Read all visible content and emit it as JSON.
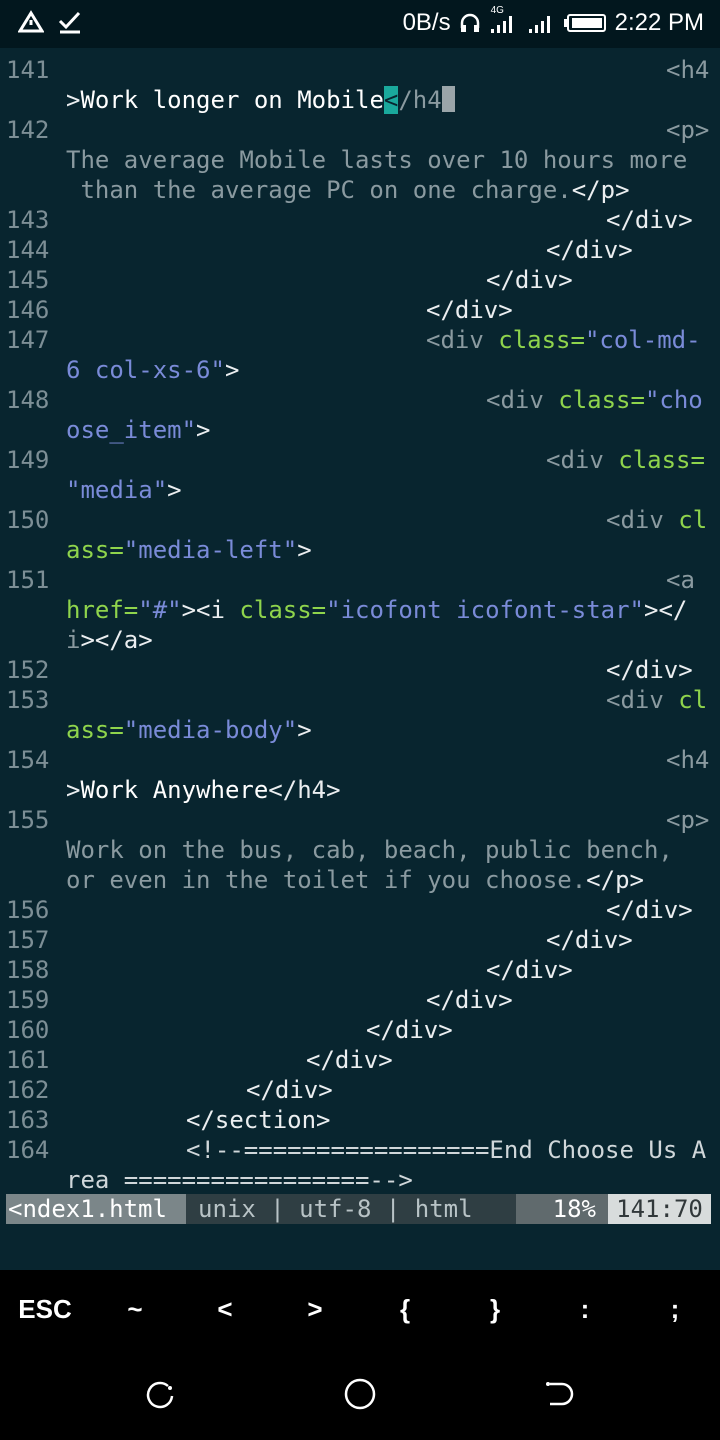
{
  "status_bar": {
    "net_speed": "0B/s",
    "network_label": "4G",
    "time": "2:22 PM",
    "icons": [
      "alert-triangle-icon",
      "check-mark-icon",
      "headphones-icon",
      "signal-4g-icon",
      "signal-icon",
      "battery-icon"
    ]
  },
  "editor": {
    "lines": [
      {
        "n": "141"
      },
      {
        "n": "142"
      },
      {
        "n": "143"
      },
      {
        "n": "144"
      },
      {
        "n": "145"
      },
      {
        "n": "146"
      },
      {
        "n": "147"
      },
      {
        "n": "148"
      },
      {
        "n": "149"
      },
      {
        "n": "150"
      },
      {
        "n": "151"
      },
      {
        "n": "152"
      },
      {
        "n": "153"
      },
      {
        "n": "154"
      },
      {
        "n": "155"
      },
      {
        "n": "156"
      },
      {
        "n": "157"
      },
      {
        "n": "158"
      },
      {
        "n": "159"
      },
      {
        "n": "160"
      },
      {
        "n": "161"
      },
      {
        "n": "162"
      },
      {
        "n": "163"
      },
      {
        "n": "164"
      }
    ],
    "text": {
      "l141a": "<h4",
      "l141b_gt": ">",
      "l141b_text": "Work longer on Mobile",
      "l141b_lt": "<",
      "l141b_tag": "/h4",
      "l142a": "<p>",
      "l142b": "The average Mobile lasts over 10 hours more",
      "l142c": " than the average PC on one charge.",
      "l142c_tag": "</p>",
      "close_div": "</div>",
      "open_div": "<div",
      "class_eq": " class=",
      "l147_str": "\"col-md-",
      "l147b_str": "6 col-xs-6\"",
      "l148_str": "\"cho",
      "l148b_str": "ose_item\"",
      "l149_str": "\"media\"",
      "cl": " cl",
      "ass_eq": "ass=",
      "l150b_str": "\"media-left\"",
      "l151a": "<a",
      "l151_href": "href=",
      "l151_hash": "\"#\"",
      "l151_i": "><i",
      "l151_cls": " class=",
      "l151_str": "\"icofont icofont-star\"",
      "l151_end": "></",
      "l151c_i": "i",
      "l151c_a": "></a>",
      "l153b_str": "\"media-body\"",
      "l154a": "<h4",
      "l154b_gt": ">",
      "l154b_text": "Work Anywhere",
      "l154b_tag": "</h4>",
      "l155a": "<p>",
      "l155b": "Work on the bus, cab, beach, public bench,",
      "l155c": "or even in the toilet if you choose.",
      "l155c_tag": "</p>",
      "section_close": "</section>",
      "l164a": "<!--=================End Choose Us A",
      "l164b": "rea =================-->",
      "gt": ">"
    }
  },
  "vim_status": {
    "filename": "<ndex1.html",
    "fileinfo": "unix | utf-8 | html",
    "percent": "18%",
    "position": "141:70"
  },
  "extra_keys": [
    "ESC",
    "~",
    "<",
    ">",
    "{",
    "}",
    ":",
    ";"
  ],
  "nav_bar": {
    "icons": [
      "recent-apps-icon",
      "home-icon",
      "back-icon"
    ]
  }
}
